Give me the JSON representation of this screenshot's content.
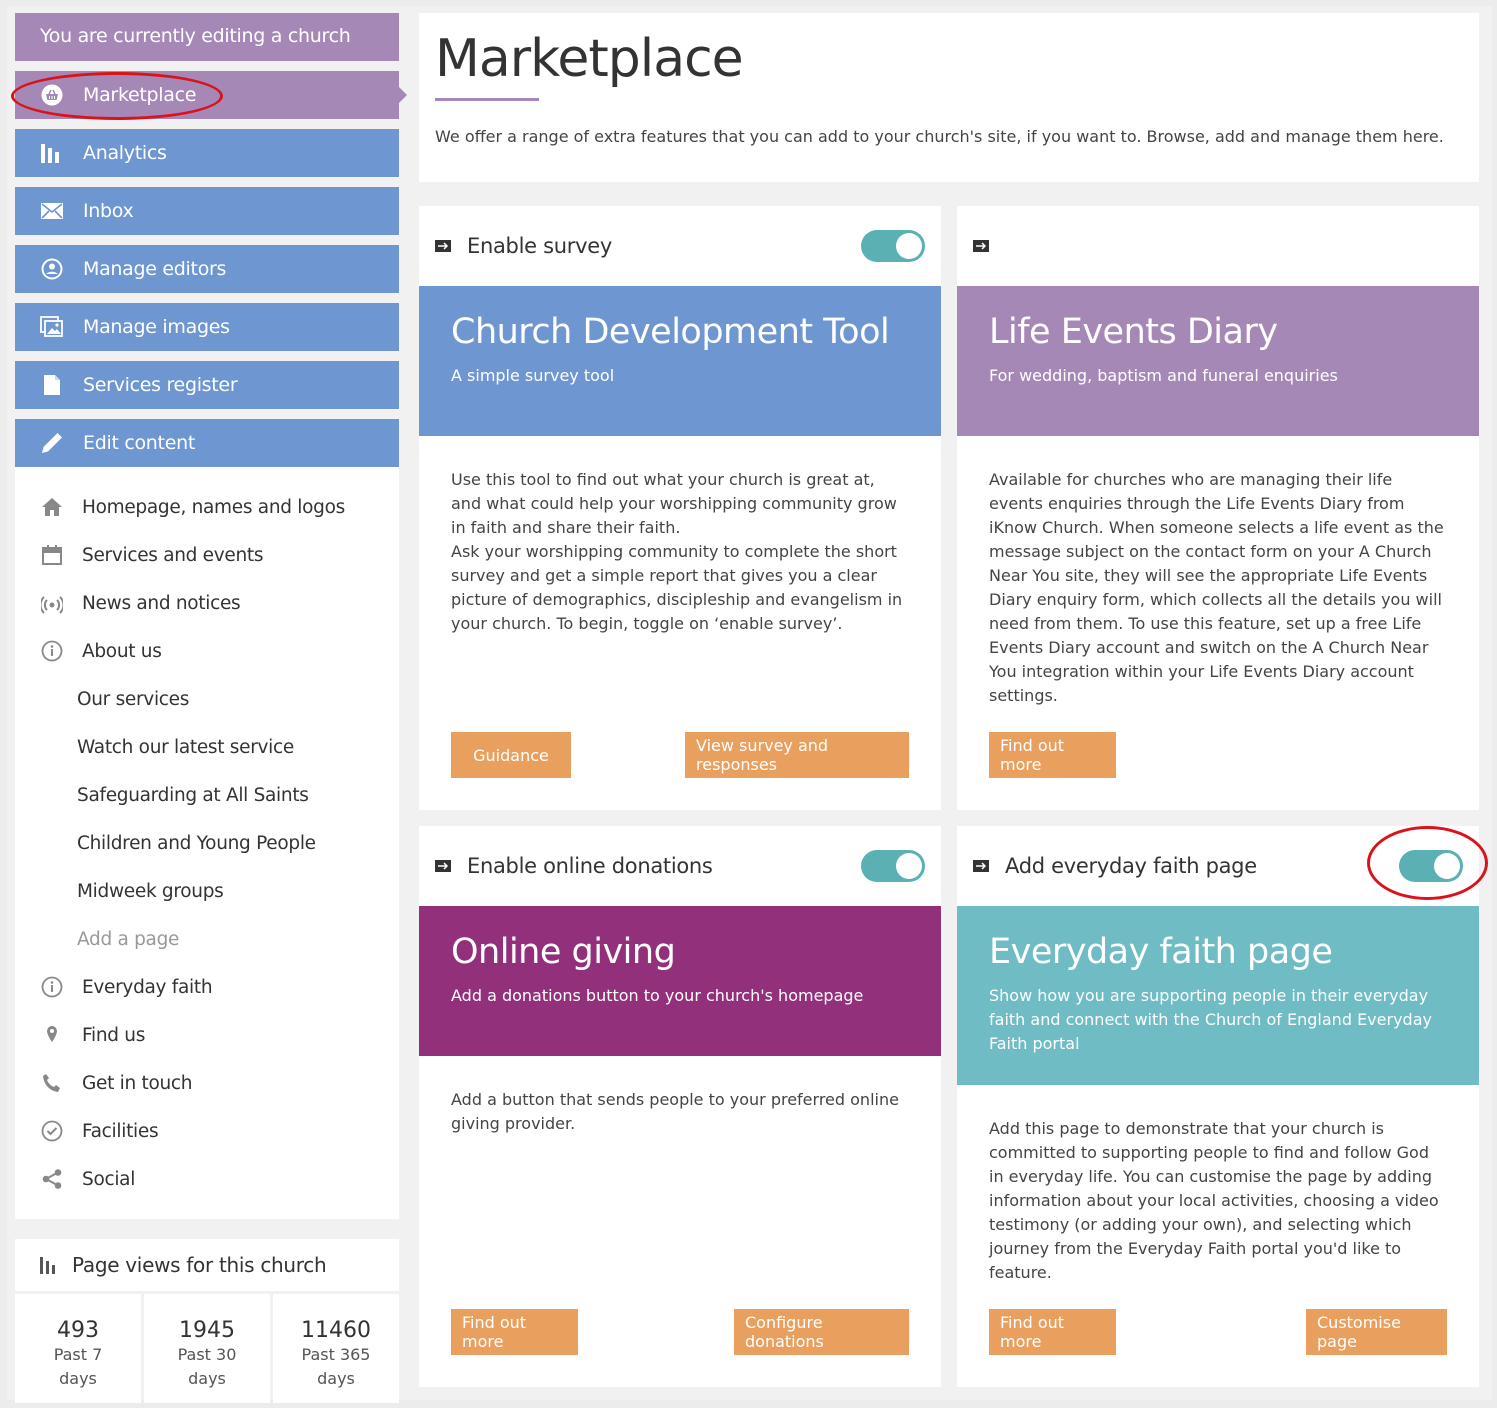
{
  "sidebar": {
    "editing_banner": "You are currently editing a church",
    "nav": [
      {
        "label": "Marketplace",
        "icon": "basket-icon"
      },
      {
        "label": "Analytics",
        "icon": "bar-chart-icon"
      },
      {
        "label": "Inbox",
        "icon": "envelope-icon"
      },
      {
        "label": "Manage editors",
        "icon": "user-circle-icon"
      },
      {
        "label": "Manage images",
        "icon": "images-icon"
      },
      {
        "label": "Services register",
        "icon": "file-icon"
      },
      {
        "label": "Edit content",
        "icon": "pencil-icon"
      }
    ],
    "submenu": [
      {
        "label": "Homepage, names and logos"
      },
      {
        "label": "Services and events"
      },
      {
        "label": "News and notices"
      },
      {
        "label": "About us"
      },
      {
        "label": "Our services"
      },
      {
        "label": "Watch our latest service"
      },
      {
        "label": "Safeguarding at All Saints"
      },
      {
        "label": "Children and Young People"
      },
      {
        "label": "Midweek groups"
      },
      {
        "label": "Add a page"
      },
      {
        "label": "Everyday faith"
      },
      {
        "label": "Find us"
      },
      {
        "label": "Get in touch"
      },
      {
        "label": "Facilities"
      },
      {
        "label": "Social"
      }
    ]
  },
  "page_views": {
    "title": "Page views for this church",
    "stats": [
      {
        "value": "493",
        "label1": "Past 7",
        "label2": "days"
      },
      {
        "value": "1945",
        "label1": "Past 30",
        "label2": "days"
      },
      {
        "value": "11460",
        "label1": "Past 365",
        "label2": "days"
      }
    ]
  },
  "header": {
    "title": "Marketplace",
    "description": "We offer a range of extra features that you can add to your church's site, if you want to. Browse, add and manage them here."
  },
  "cards": [
    {
      "toggle_label": "Enable survey",
      "toggle_on": true,
      "banner_title": "Church Development Tool",
      "banner_subtitle": "A simple survey tool",
      "banner_color": "#6e96d1",
      "body_p1": "Use this tool to find out what your church is great at, and what could help your worshipping community grow in faith and share their faith.",
      "body_p2": "Ask your worshipping community to complete the short survey and get a simple report that gives you a clear picture of demographics, discipleship and evangelism in your church. To begin, toggle on ‘enable survey’.",
      "button_left": "Guidance",
      "button_right": "View survey and responses"
    },
    {
      "toggle_label": "",
      "toggle_on": false,
      "banner_title": "Life Events Diary",
      "banner_subtitle": "For wedding, baptism and funeral enquiries",
      "banner_color": "#a688b7",
      "body_p1": "Available for churches who are managing their life events enquiries through the Life Events Diary from iKnow Church. When someone selects a life event as the message subject on the contact form on your A Church Near You site, they will see the appropriate Life Events Diary enquiry form, which collects all the details you will need from them. To use this feature, set up a free Life Events Diary account and switch on the A Church Near You integration within your Life Events Diary account settings.",
      "button_left": "Find out more"
    },
    {
      "toggle_label": "Enable online donations",
      "toggle_on": true,
      "banner_title": "Online giving",
      "banner_subtitle": "Add a donations button to your church's homepage",
      "banner_color": "#93307b",
      "body_p1": "Add a button that sends people to your preferred online giving provider.",
      "button_left": "Find out more",
      "button_right": "Configure donations"
    },
    {
      "toggle_label": "Add everyday faith page",
      "toggle_on": true,
      "banner_title": "Everyday faith page",
      "banner_subtitle": "Show how you are supporting people in their everyday faith and connect with the Church of England Everyday Faith portal",
      "banner_color": "#6fbcc4",
      "body_p1": "Add this page to demonstrate that your church is committed to supporting people to find and follow God in everyday life. You can customise the page by adding information about your local activities, choosing a video testimony (or adding your own), and selecting which journey from the Everyday Faith portal you'd like to feature.",
      "button_left": "Find out more",
      "button_right": "Customise page"
    }
  ],
  "colors": {
    "purple": "#a688b7",
    "blue": "#6e96d1",
    "toggle": "#5ab0b3",
    "button": "#e9a05f",
    "annotation": "#d9131b"
  }
}
